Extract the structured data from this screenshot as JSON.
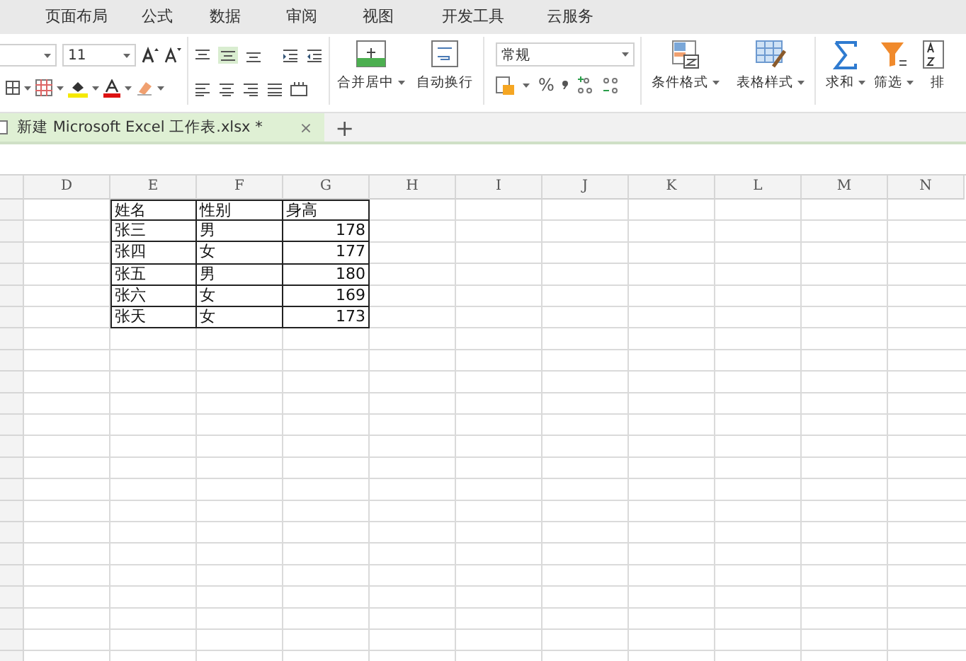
{
  "menu": [
    {
      "label": "页面布局"
    },
    {
      "label": "公式"
    },
    {
      "label": "数据"
    },
    {
      "label": "审阅"
    },
    {
      "label": "视图"
    },
    {
      "label": "开发工具"
    },
    {
      "label": "云服务"
    }
  ],
  "ribbon": {
    "font_size": "11",
    "number_format": "常规",
    "percent": "%",
    "big_buttons": [
      {
        "label": "合并居中",
        "kind": "merge"
      },
      {
        "label": "自动换行",
        "kind": "wrap"
      },
      {
        "label": "条件格式",
        "kind": "conditional"
      },
      {
        "label": "表格样式",
        "kind": "tablestyle"
      },
      {
        "label": "求和",
        "kind": "sum"
      },
      {
        "label": "筛选",
        "kind": "filter"
      },
      {
        "label": "排",
        "kind": "sort"
      }
    ]
  },
  "document_tabs": [
    {
      "title": "新建 Microsoft Excel 工作表.xlsx *",
      "close": "×",
      "selected": true
    }
  ],
  "new_tab": "+",
  "sheet": {
    "column_headers": [
      "D",
      "E",
      "F",
      "G",
      "H",
      "I",
      "J",
      "K",
      "L",
      "M",
      "N"
    ],
    "rows": [
      [
        "姓名",
        "性别",
        "身高"
      ],
      [
        "张三",
        "男",
        "178"
      ],
      [
        "张四",
        "女",
        "177"
      ],
      [
        "张五",
        "男",
        "180"
      ],
      [
        "张六",
        "女",
        "169"
      ],
      [
        "张天",
        "女",
        "173"
      ]
    ]
  }
}
